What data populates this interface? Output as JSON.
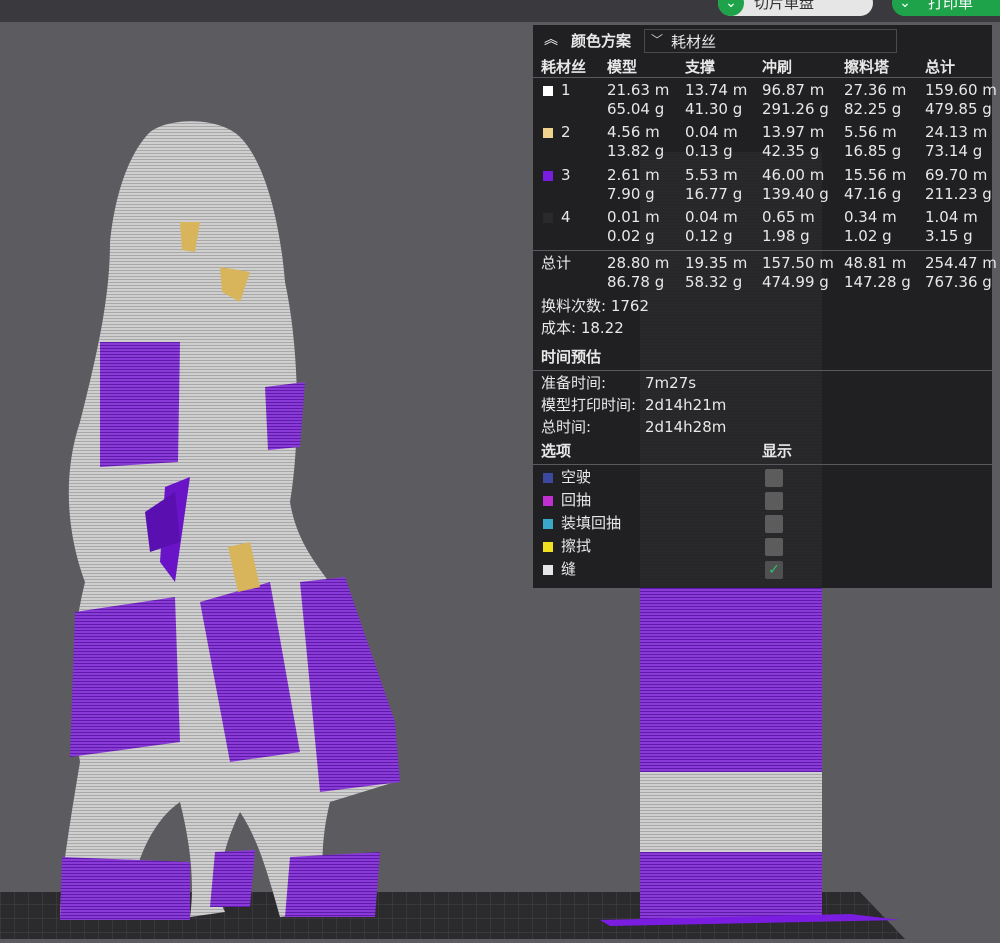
{
  "toolbar": {
    "slice_label": "切片单盘",
    "print_label": "打印单"
  },
  "panel": {
    "title": "颜色方案",
    "scheme_value": "耗材丝",
    "columns": [
      "耗材丝",
      "模型",
      "支撑",
      "冲刷",
      "擦料塔",
      "总计"
    ],
    "filaments": [
      {
        "id": "1",
        "color": "#ffffff",
        "model": [
          "21.63 m",
          "65.04 g"
        ],
        "support": [
          "13.74 m",
          "41.30 g"
        ],
        "flush": [
          "96.87 m",
          "291.26 g"
        ],
        "tower": [
          "27.36 m",
          "82.25 g"
        ],
        "total": [
          "159.60 m",
          "479.85 g"
        ]
      },
      {
        "id": "2",
        "color": "#f0d28c",
        "model": [
          "4.56 m",
          "13.82 g"
        ],
        "support": [
          "0.04 m",
          "0.13 g"
        ],
        "flush": [
          "13.97 m",
          "42.35 g"
        ],
        "tower": [
          "5.56 m",
          "16.85 g"
        ],
        "total": [
          "24.13 m",
          "73.14 g"
        ]
      },
      {
        "id": "3",
        "color": "#7a1de0",
        "model": [
          "2.61 m",
          "7.90 g"
        ],
        "support": [
          "5.53 m",
          "16.77 g"
        ],
        "flush": [
          "46.00 m",
          "139.40 g"
        ],
        "tower": [
          "15.56 m",
          "47.16 g"
        ],
        "total": [
          "69.70 m",
          "211.23 g"
        ]
      },
      {
        "id": "4",
        "color": "#2a2a2a",
        "model": [
          "0.01 m",
          "0.02 g"
        ],
        "support": [
          "0.04 m",
          "0.12 g"
        ],
        "flush": [
          "0.65 m",
          "1.98 g"
        ],
        "tower": [
          "0.34 m",
          "1.02 g"
        ],
        "total": [
          "1.04 m",
          "3.15 g"
        ]
      }
    ],
    "totals": {
      "label": "总计",
      "model": [
        "28.80 m",
        "86.78 g"
      ],
      "support": [
        "19.35 m",
        "58.32 g"
      ],
      "flush": [
        "157.50 m",
        "474.99 g"
      ],
      "tower": [
        "48.81 m",
        "147.28 g"
      ],
      "total": [
        "254.47 m",
        "767.36 g"
      ]
    },
    "changes": "换料次数: 1762",
    "cost": "成本: 18.22",
    "time_title": "时间预估",
    "times": [
      {
        "label": "准备时间:",
        "value": "7m27s"
      },
      {
        "label": "模型打印时间:",
        "value": "2d14h21m"
      },
      {
        "label": "总时间:",
        "value": "2d14h28m"
      }
    ],
    "options_title": "选项",
    "show_title": "显示",
    "options": [
      {
        "label": "空驶",
        "color": "#3b4aa0",
        "checked": false
      },
      {
        "label": "回抽",
        "color": "#c030d0",
        "checked": false
      },
      {
        "label": "装填回抽",
        "color": "#3aa8c8",
        "checked": false
      },
      {
        "label": "擦拭",
        "color": "#f0e020",
        "checked": false
      },
      {
        "label": "缝",
        "color": "#e6e6e6",
        "checked": true
      }
    ]
  }
}
